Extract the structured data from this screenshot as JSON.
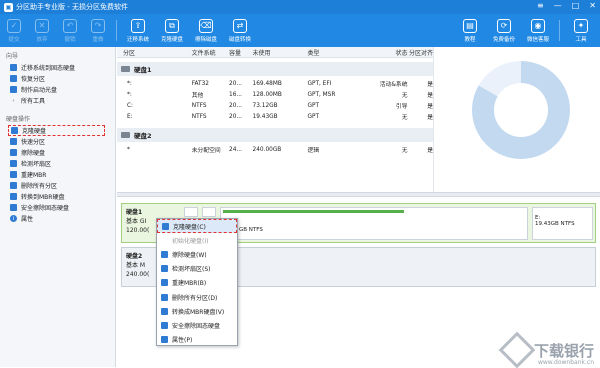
{
  "window": {
    "title": "分区助手专业版 - 无损分区免费软件"
  },
  "toolbar": {
    "left": [
      {
        "label": "提交",
        "icon": "check-icon",
        "enabled": false
      },
      {
        "label": "放弃",
        "icon": "discard-icon",
        "enabled": false
      },
      {
        "label": "撤销",
        "icon": "undo-icon",
        "enabled": false
      },
      {
        "label": "重做",
        "icon": "redo-icon",
        "enabled": false
      }
    ],
    "main": [
      {
        "label": "迁移系统",
        "icon": "migrate-icon"
      },
      {
        "label": "克隆硬盘",
        "icon": "clone-icon"
      },
      {
        "label": "擦除磁盘",
        "icon": "wipe-icon"
      },
      {
        "label": "磁盘转换",
        "icon": "convert-icon"
      }
    ],
    "right": [
      {
        "label": "教程",
        "icon": "tutorial-icon"
      },
      {
        "label": "免费备份",
        "icon": "backup-icon"
      },
      {
        "label": "微信客服",
        "icon": "wechat-icon"
      },
      {
        "label": "工具",
        "icon": "tools-icon"
      }
    ]
  },
  "sidebar": {
    "wizard_title": "向导",
    "wizard_items": [
      "迁移系统到固态硬盘",
      "恢复分区",
      "制作启动光盘",
      "所有工具"
    ],
    "disk_title": "硬盘操作",
    "disk_items": [
      "克隆硬盘",
      "快速分区",
      "擦除硬盘",
      "检测坏扇区",
      "重建MBR",
      "删除所有分区",
      "转换到MBR硬盘",
      "安全擦除固态硬盘",
      "属性"
    ]
  },
  "table": {
    "headers": [
      "分区",
      "文件系统",
      "容量",
      "未使用",
      "类型",
      "状态",
      "分区对齐"
    ],
    "disk1": "硬盘1",
    "disk1_rows": [
      [
        "*:",
        "FAT32",
        "20...",
        "169.48MB",
        "GPT, EFI",
        "活动&系统",
        "是"
      ],
      [
        "*:",
        "其他",
        "16...",
        "128.00MB",
        "GPT, MSR",
        "无",
        "是"
      ],
      [
        "C:",
        "NTFS",
        "20...",
        "73.12GB",
        "GPT",
        "引导",
        "是"
      ],
      [
        "E:",
        "NTFS",
        "20...",
        "19.43GB",
        "GPT",
        "无",
        "是"
      ]
    ],
    "disk2": "硬盘2",
    "disk2_rows": [
      [
        "*",
        "未分配空间",
        "24...",
        "240.00GB",
        "逻辑",
        "无",
        "是"
      ]
    ]
  },
  "map": {
    "disk1_name": "硬盘1",
    "disk1_type": "基本 GI",
    "disk1_size": "120.00(",
    "disk1_partC": "GB NTFS",
    "disk1_partE_label": "E:",
    "disk1_partE": "19.43GB NTFS",
    "disk2_name": "硬盘2",
    "disk2_type": "基本 M",
    "disk2_size": "240.00("
  },
  "context_menu": [
    {
      "label": "克隆硬盘(C)",
      "enabled": true,
      "selected": true
    },
    {
      "label": "初始化硬盘(I)",
      "enabled": false
    },
    {
      "label": "擦除硬盘(W)",
      "enabled": true
    },
    {
      "label": "检测坏扇区(S)",
      "enabled": true
    },
    {
      "label": "重建MBR(B)",
      "enabled": true
    },
    {
      "label": "删除所有分区(D)",
      "enabled": true
    },
    {
      "label": "转换成MBR硬盘(V)",
      "enabled": true
    },
    {
      "label": "安全擦除固态硬盘",
      "enabled": true
    },
    {
      "label": "属性(P)",
      "enabled": true
    }
  ],
  "watermark": {
    "text": "下载银行",
    "url": "www.downbank.cn"
  }
}
